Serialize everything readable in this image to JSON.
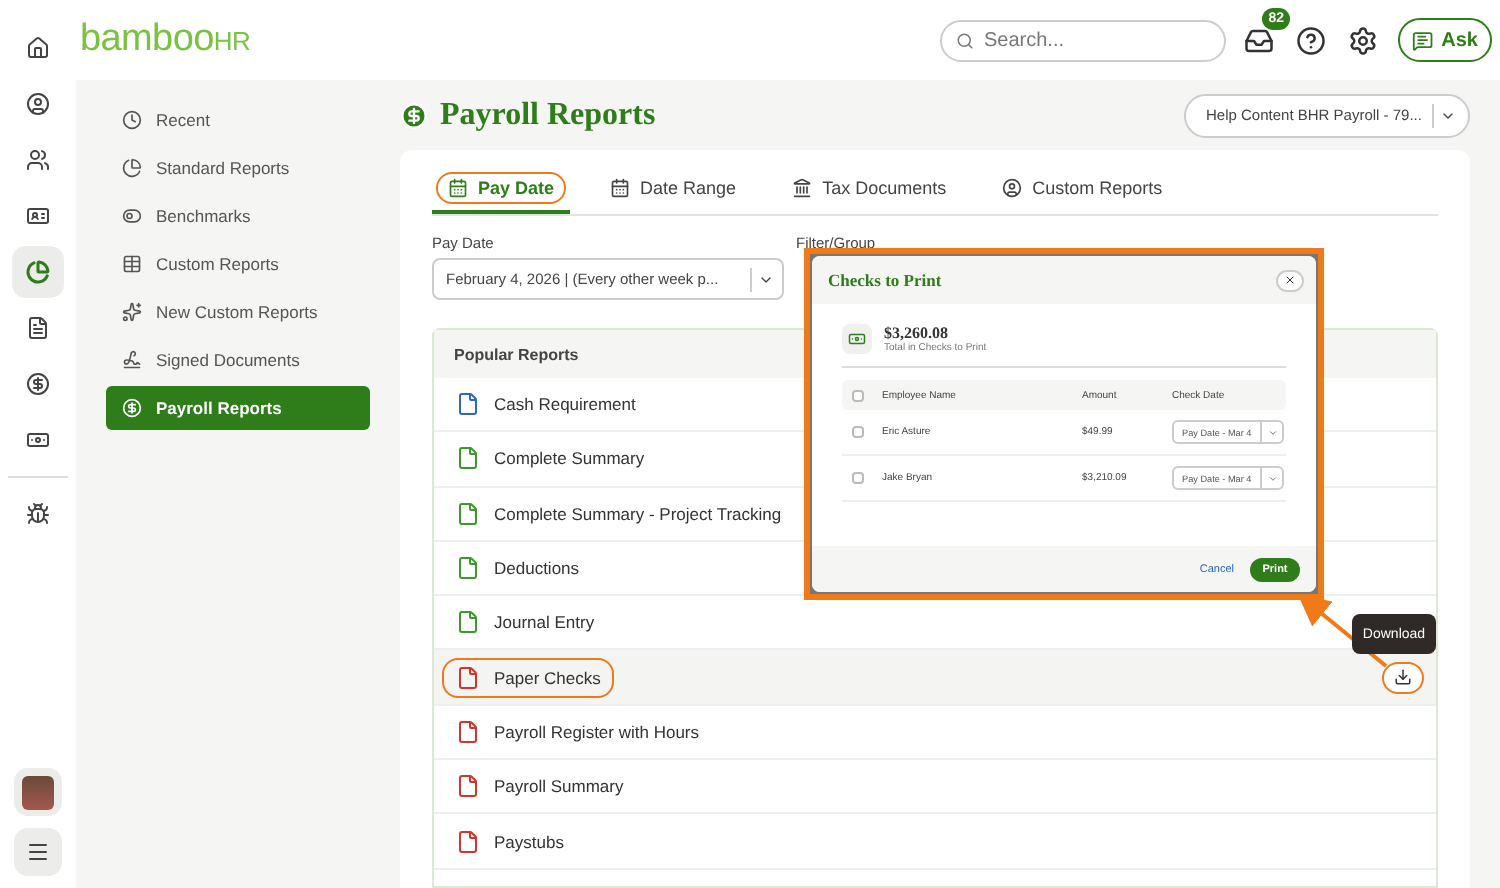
{
  "logo": {
    "text": "bamboo",
    "suffix": "HR"
  },
  "header": {
    "search": {
      "placeholder": "Search..."
    },
    "notifications": "82",
    "ask": "Ask"
  },
  "rail": [
    {
      "selected": false
    },
    {
      "selected": false
    },
    {
      "selected": false
    },
    {
      "selected": false
    },
    {
      "selected": true
    },
    {
      "selected": false
    },
    {
      "selected": false
    },
    {
      "selected": false
    },
    {
      "selected": false
    }
  ],
  "sidebar": {
    "items": [
      {
        "label": "Recent",
        "selected": false
      },
      {
        "label": "Standard Reports",
        "selected": false
      },
      {
        "label": "Benchmarks",
        "selected": false
      },
      {
        "label": "Custom Reports",
        "selected": false
      },
      {
        "label": "New Custom Reports",
        "selected": false
      },
      {
        "label": "Signed Documents",
        "selected": false
      },
      {
        "label": "Payroll Reports",
        "selected": true
      }
    ]
  },
  "page": {
    "title": "Payroll Reports",
    "account": "Help Content BHR Payroll - 79..."
  },
  "tabs": [
    {
      "label": "Pay Date",
      "selected": true,
      "highlighted": true
    },
    {
      "label": "Date Range",
      "selected": false,
      "highlighted": false
    },
    {
      "label": "Tax Documents",
      "selected": false,
      "highlighted": false
    },
    {
      "label": "Custom Reports",
      "selected": false,
      "highlighted": false
    }
  ],
  "filters": {
    "pay_date_label": "Pay Date",
    "pay_date_value": "February 4, 2026 | (Every other week p...",
    "filter_label": "Filter/Group"
  },
  "reports": {
    "title": "Popular Reports",
    "rows": [
      {
        "label": "Cash Requirement",
        "kind": "doc",
        "highlighted": false
      },
      {
        "label": "Complete Summary",
        "kind": "sheet",
        "highlighted": false
      },
      {
        "label": "Complete Summary - Project Tracking",
        "kind": "sheet",
        "highlighted": false
      },
      {
        "label": "Deductions",
        "kind": "sheet",
        "highlighted": false
      },
      {
        "label": "Journal Entry",
        "kind": "sheet",
        "highlighted": false
      },
      {
        "label": "Paper Checks",
        "kind": "pdf",
        "highlighted": true
      },
      {
        "label": "Payroll Register with Hours",
        "kind": "pdf",
        "highlighted": false
      },
      {
        "label": "Payroll Summary",
        "kind": "pdf",
        "highlighted": false
      },
      {
        "label": "Paystubs",
        "kind": "pdf",
        "highlighted": false
      }
    ]
  },
  "tooltip": "Download",
  "modal": {
    "title": "Checks to Print",
    "total": "$3,260.08",
    "total_label": "Total in Checks to Print",
    "columns": [
      "Employee Name",
      "Amount",
      "Check Date"
    ],
    "header_checked": false,
    "rows": [
      {
        "name": "Eric Asture",
        "amount": "$49.99",
        "date": "Pay Date - Mar 4",
        "checked": false
      },
      {
        "name": "Jake Bryan",
        "amount": "$3,210.09",
        "date": "Pay Date - Mar 4",
        "checked": false
      }
    ],
    "cancel": "Cancel",
    "print": "Print"
  }
}
